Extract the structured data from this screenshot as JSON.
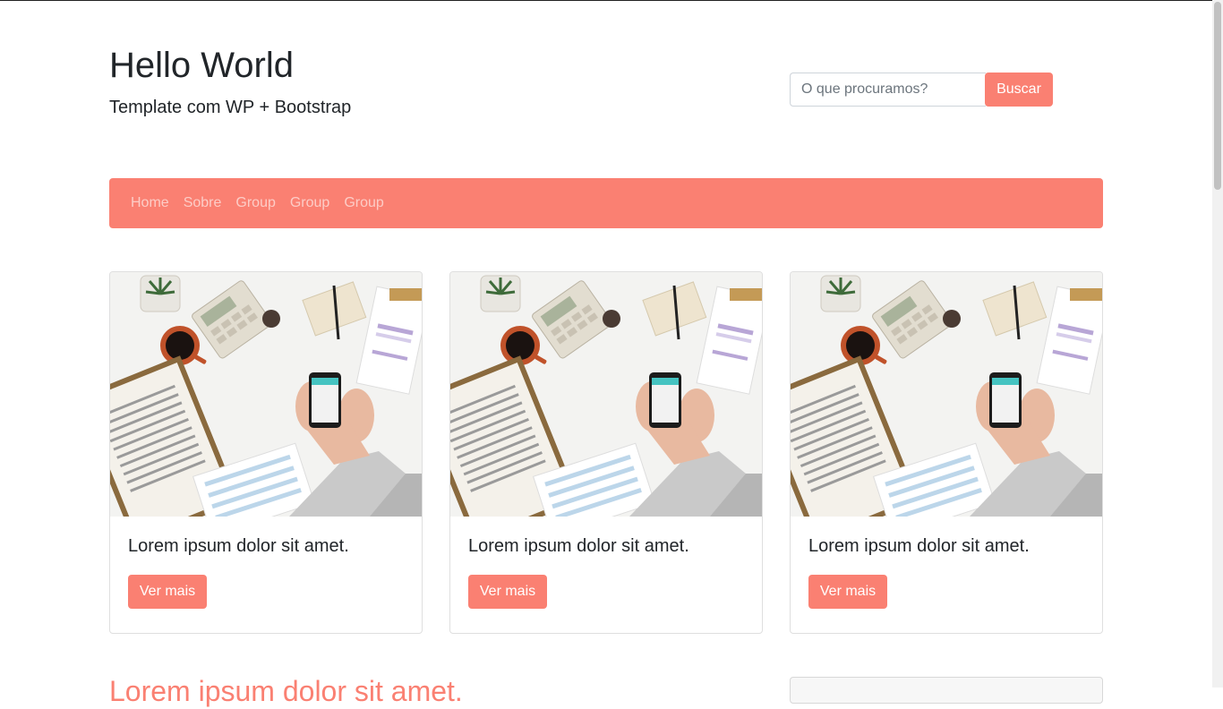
{
  "header": {
    "title": "Hello World",
    "subtitle": "Template com WP + Bootstrap"
  },
  "search": {
    "placeholder": "O que procuramos?",
    "button_label": "Buscar"
  },
  "nav": {
    "items": [
      {
        "label": "Home"
      },
      {
        "label": "Sobre"
      },
      {
        "label": "Group"
      },
      {
        "label": "Group"
      },
      {
        "label": "Group"
      }
    ]
  },
  "cards": [
    {
      "title": "Lorem ipsum dolor sit amet.",
      "button_label": "Ver mais",
      "image": "desk-flatlay-image"
    },
    {
      "title": "Lorem ipsum dolor sit amet.",
      "button_label": "Ver mais",
      "image": "desk-flatlay-image"
    },
    {
      "title": "Lorem ipsum dolor sit amet.",
      "button_label": "Ver mais",
      "image": "desk-flatlay-image"
    }
  ],
  "bottom": {
    "heading": "Lorem ipsum dolor sit amet."
  },
  "colors": {
    "accent": "#fa8072",
    "text": "#212529"
  }
}
